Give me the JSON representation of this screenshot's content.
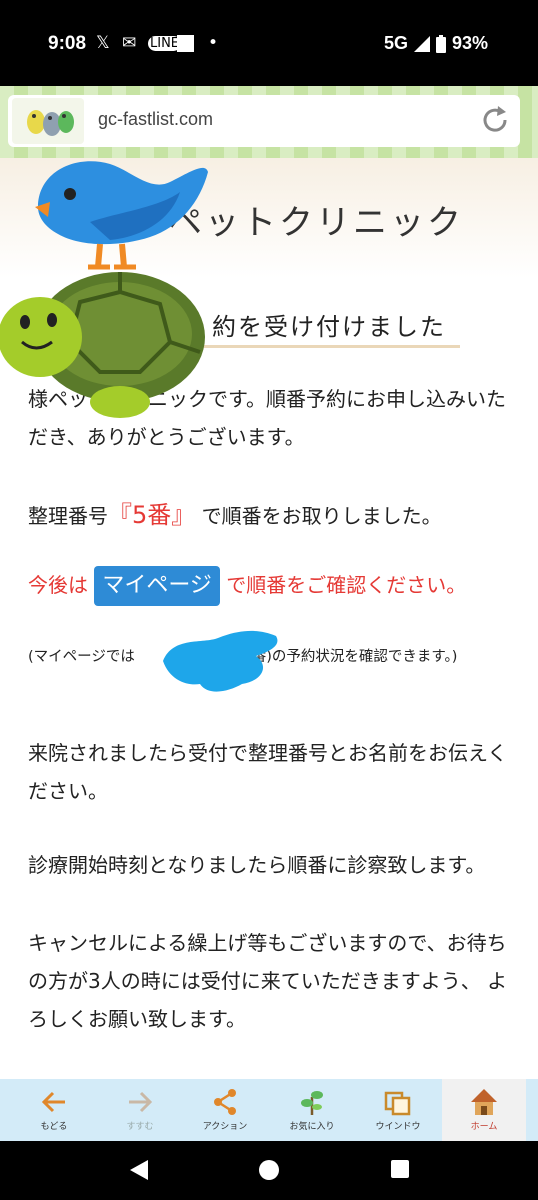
{
  "status": {
    "time": "9:08",
    "network": "5G",
    "battery": "93%"
  },
  "browser": {
    "url": "gc-fastlist.com"
  },
  "page": {
    "site_title": "ペットクリニック",
    "heading": "約を受け付けました",
    "para1": "様ペットクリニックです。順番予約にお申し込みいただき、ありがとうございます。",
    "para2_before": "整理番号",
    "para2_number": "『5番』",
    "para2_after": "で順番をお取りしました。",
    "para3_before": "今後は",
    "mypage_button": "マイページ",
    "para3_after": "で順番をご確認ください。",
    "small_before": "(マイページでは",
    "small_after": "(5番)の予約状況を確認できます。)",
    "para4": "来院されましたら受付で整理番号とお名前をお伝えください。",
    "para5": "診療開始時刻となりましたら順番に診察致します。",
    "para6": "キャンセルによる繰上げ等もございますので、お待ちの方が3人の時には受付に来ていただきますよう、 よろしくお願い致します。"
  },
  "bottom_nav": [
    {
      "label": "もどる",
      "icon": "arrow-left-icon"
    },
    {
      "label": "すすむ",
      "icon": "arrow-right-icon"
    },
    {
      "label": "アクション",
      "icon": "share-icon"
    },
    {
      "label": "お気に入り",
      "icon": "plant-icon"
    },
    {
      "label": "ウインドウ",
      "icon": "window-icon"
    },
    {
      "label": "ホーム",
      "icon": "home-icon"
    }
  ],
  "colors": {
    "accent_red": "#e53935",
    "button_blue": "#2e8bd6",
    "nav_bg": "#d3ebf8"
  }
}
